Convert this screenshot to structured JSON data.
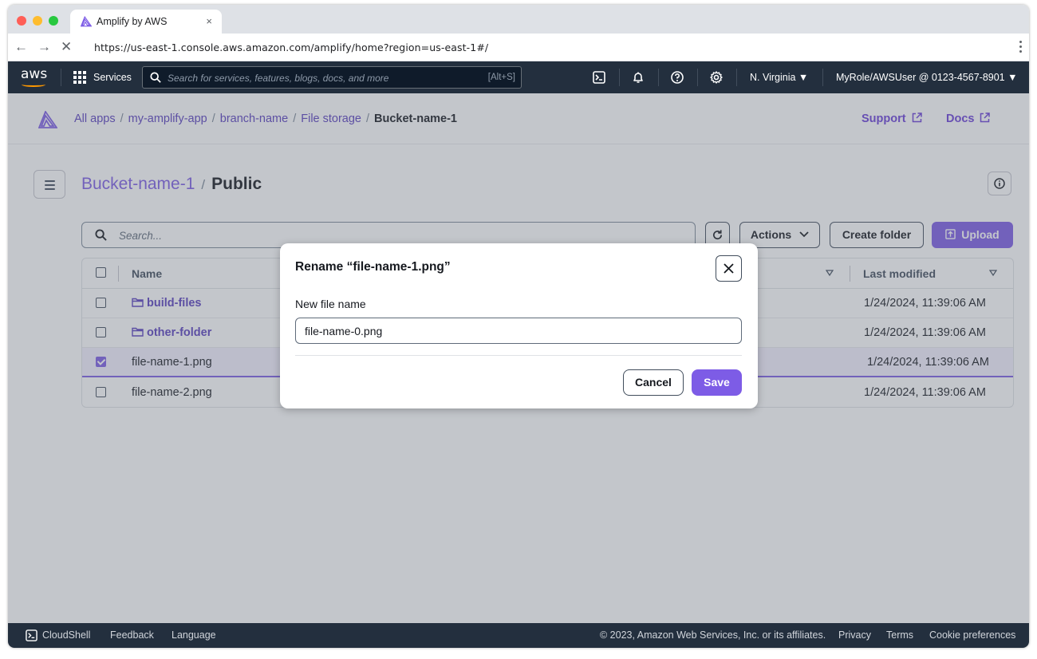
{
  "browser": {
    "tab_title": "Amplify by AWS",
    "tab_close": "×",
    "url": "https://us-east-1.console.aws.amazon.com/amplify/home?region=us-east-1#/"
  },
  "aws_nav": {
    "logo": "aws",
    "services": "Services",
    "search_placeholder": "Search for services, features, blogs, docs, and more",
    "search_shortcut": "[Alt+S]",
    "region": "N. Virginia ▼",
    "account": "MyRole/AWSUser @ 0123-4567-8901 ▼",
    "accent_color": "#ff9900"
  },
  "breadcrumbs": {
    "items": [
      "All apps",
      "my-amplify-app",
      "branch-name",
      "File storage"
    ],
    "current": "Bucket-name-1",
    "support": "Support",
    "docs": "Docs"
  },
  "header": {
    "bucket": "Bucket-name-1",
    "folder": "Public"
  },
  "toolbar": {
    "search_placeholder": "Search...",
    "actions": "Actions",
    "create_folder": "Create folder",
    "upload": "Upload"
  },
  "table": {
    "columns": {
      "name": "Name",
      "last_modified": "Last modified"
    },
    "rows": [
      {
        "name": "build-files",
        "type": "folder",
        "modified": "1/24/2024, 11:39:06 AM",
        "selected": false
      },
      {
        "name": "other-folder",
        "type": "folder",
        "modified": "1/24/2024, 11:39:06 AM",
        "selected": false
      },
      {
        "name": "file-name-1.png",
        "type": "file",
        "modified": "1/24/2024, 11:39:06 AM",
        "selected": true
      },
      {
        "name": "file-name-2.png",
        "type": "file",
        "modified": "1/24/2024, 11:39:06 AM",
        "selected": false
      }
    ]
  },
  "modal": {
    "title": "Rename “file-name-1.png”",
    "label": "New file name",
    "value": "file-name-0.png",
    "cancel": "Cancel",
    "save": "Save"
  },
  "footer": {
    "cloudshell": "CloudShell",
    "feedback": "Feedback",
    "language": "Language",
    "copyright": "© 2023, Amazon Web Services, Inc. or its affiliates.",
    "privacy": "Privacy",
    "terms": "Terms",
    "cookies": "Cookie preferences"
  },
  "colors": {
    "brand": "#7d5ce6",
    "nav_bg": "#232f3e"
  }
}
